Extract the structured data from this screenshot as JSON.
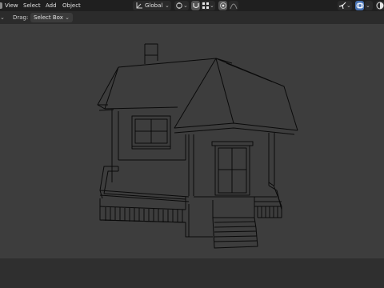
{
  "header": {
    "menu": [
      "View",
      "Select",
      "Add",
      "Object"
    ],
    "transform_orientation": "Global"
  },
  "toolbar": {
    "drag_label": "Drag:",
    "drag_mode": "Select Box"
  },
  "icons": {
    "orientation": "transform-orientation-icon",
    "pivot": "pivot-point-icon",
    "snap": "snap-magnet-icon",
    "snap_target": "snap-grid-icon",
    "proportional": "proportional-edit-icon",
    "falloff": "falloff-curve-icon",
    "gizmo": "gizmo-icon",
    "overlay": "overlay-icon",
    "shading": "viewport-shading-icon"
  },
  "colors": {
    "header_bg": "#1f1f1f",
    "toolbar_bg": "#2b2b2b",
    "viewport_bg": "#3d3d3d",
    "accent_active": "#4772b3",
    "wire": "#0a0a0a"
  }
}
